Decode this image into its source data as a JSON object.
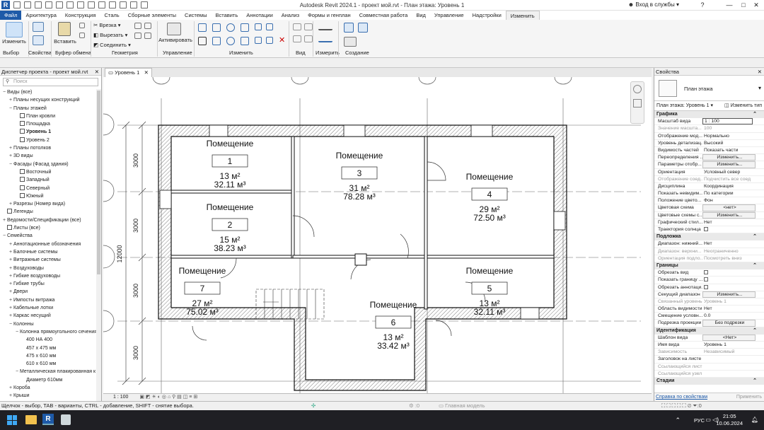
{
  "app": {
    "window_title": "Autodesk Revit 2024.1 - проект мой.rvt - План этажа: Уровень 1",
    "sign_in": "Вход в службы",
    "logo": "R"
  },
  "tabs": [
    "Файл",
    "Архитектура",
    "Конструкция",
    "Сталь",
    "Сборные элементы",
    "Системы",
    "Вставить",
    "Аннотации",
    "Анализ",
    "Формы и генплан",
    "Совместная работа",
    "Вид",
    "Управление",
    "Надстройки",
    "Изменить"
  ],
  "active_tab": "Изменить",
  "ribbon": {
    "modify": "Изменить",
    "paste": "Вставить",
    "cut_geom": "Врезка",
    "cut": "Вырезать",
    "join": "Соединить",
    "activate": "Активировать",
    "panels": {
      "select": "Выбор",
      "properties": "Свойства",
      "clipboard": "Буфер обмена",
      "geometry": "Геометрия",
      "control": "Управление",
      "modify": "Изменить",
      "view": "Вид",
      "measure": "Измерить",
      "create": "Создание"
    }
  },
  "browser": {
    "title": "Диспетчер проекта - проект мой.rvt",
    "search_placeholder": "Поиск",
    "items": [
      {
        "t": "Виды (все)",
        "l": 0,
        "e": "−"
      },
      {
        "t": "Планы несущих конструкций",
        "l": 1,
        "e": "+"
      },
      {
        "t": "Планы этажей",
        "l": 1,
        "e": "−"
      },
      {
        "t": "План кровли",
        "l": 2,
        "v": true
      },
      {
        "t": "Площадка",
        "l": 2,
        "v": true
      },
      {
        "t": "Уровень 1",
        "l": 2,
        "v": true,
        "b": true
      },
      {
        "t": "Уровень 2",
        "l": 2,
        "v": true
      },
      {
        "t": "Планы потолков",
        "l": 1,
        "e": "+"
      },
      {
        "t": "3D виды",
        "l": 1,
        "e": "+"
      },
      {
        "t": "Фасады (Фасад здания)",
        "l": 1,
        "e": "−"
      },
      {
        "t": "Восточный",
        "l": 2,
        "v": true
      },
      {
        "t": "Западный",
        "l": 2,
        "v": true
      },
      {
        "t": "Северный",
        "l": 2,
        "v": true
      },
      {
        "t": "Южный",
        "l": 2,
        "v": true
      },
      {
        "t": "Разрезы (Номер вида)",
        "l": 1,
        "e": "+"
      },
      {
        "t": "Легенды",
        "l": 0,
        "v": true
      },
      {
        "t": "Ведомости/Спецификации (все)",
        "l": 0,
        "e": "+"
      },
      {
        "t": "Листы (все)",
        "l": 0,
        "v": true
      },
      {
        "t": "Семейства",
        "l": 0,
        "e": "−"
      },
      {
        "t": "Аннотационные обозначения",
        "l": 1,
        "e": "+"
      },
      {
        "t": "Балочные системы",
        "l": 1,
        "e": "+"
      },
      {
        "t": "Витражные системы",
        "l": 1,
        "e": "+"
      },
      {
        "t": "Воздуховоды",
        "l": 1,
        "e": "+"
      },
      {
        "t": "Гибкие воздуховоды",
        "l": 1,
        "e": "+"
      },
      {
        "t": "Гибкие трубы",
        "l": 1,
        "e": "+"
      },
      {
        "t": "Двери",
        "l": 1,
        "e": "+"
      },
      {
        "t": "Импосты витража",
        "l": 1,
        "e": "+"
      },
      {
        "t": "Кабельные лотки",
        "l": 1,
        "e": "+"
      },
      {
        "t": "Каркас несущий",
        "l": 1,
        "e": "+"
      },
      {
        "t": "Колонны",
        "l": 1,
        "e": "−"
      },
      {
        "t": "Колонна прямоугольного сечения",
        "l": 2,
        "e": "−"
      },
      {
        "t": "400 НА 400",
        "l": 3
      },
      {
        "t": "457 x 475 мм",
        "l": 3
      },
      {
        "t": "475 x 610 мм",
        "l": 3
      },
      {
        "t": "610 x 610 мм",
        "l": 3
      },
      {
        "t": "Металлическая плакированная к",
        "l": 2,
        "e": "−"
      },
      {
        "t": "Диаметр 610мм",
        "l": 3
      },
      {
        "t": "Короба",
        "l": 1,
        "e": "+"
      },
      {
        "t": "Крыши",
        "l": 1,
        "e": "+"
      }
    ]
  },
  "view_tab": "Уровень 1",
  "view_scale": "1 : 100",
  "plan": {
    "room_label": "Помещение",
    "rooms": [
      {
        "n": "1",
        "area": "13 м²",
        "vol": "32.11 м³"
      },
      {
        "n": "2",
        "area": "15 м²",
        "vol": "38.23 м³"
      },
      {
        "n": "3",
        "area": "31 м²",
        "vol": "78.28 м³"
      },
      {
        "n": "4",
        "area": "29 м²",
        "vol": "72.50 м³"
      },
      {
        "n": "5",
        "area": "13 м²",
        "vol": "32.11 м³"
      },
      {
        "n": "6",
        "area": "13 м²",
        "vol": "33.42 м³"
      },
      {
        "n": "7",
        "area": "27 м²",
        "vol": "75.02 м³"
      }
    ],
    "dims": {
      "d1": "3000",
      "d2": "3000",
      "d3": "3000",
      "d4": "3000",
      "total": "12000"
    }
  },
  "props": {
    "title": "Свойства",
    "type_name": "План этажа",
    "instance": "План этажа: Уровень 1",
    "edit_type": "Изменить тип",
    "sections": {
      "graphics": "Графика",
      "underlay": "Подложка",
      "extents": "Границы",
      "identity": "Идентификация",
      "phasing": "Стадии"
    },
    "graphics": [
      {
        "k": "Масштаб вида",
        "v": "1 : 100",
        "input": true
      },
      {
        "k": "Значение масшта...",
        "v": "100",
        "dis": true
      },
      {
        "k": "Отображение мод...",
        "v": "Нормально"
      },
      {
        "k": "Уровень детализац...",
        "v": "Высокий"
      },
      {
        "k": "Видимость частей",
        "v": "Показать части"
      },
      {
        "k": "Переопределения ...",
        "v": "Изменить...",
        "btn": true
      },
      {
        "k": "Параметры отобр...",
        "v": "Изменить...",
        "btn": true
      },
      {
        "k": "Ориентация",
        "v": "Условный север"
      },
      {
        "k": "Отображение соед...",
        "v": "Подчистить все соед",
        "dis": true
      },
      {
        "k": "Дисциплина",
        "v": "Координация"
      },
      {
        "k": "Показать невидим...",
        "v": "По категории"
      },
      {
        "k": "Положение цвето...",
        "v": "Фон"
      },
      {
        "k": "Цветовая схема",
        "v": "<нет>",
        "btn": true
      },
      {
        "k": "Цветовые схемы с...",
        "v": "Изменить...",
        "btn": true
      },
      {
        "k": "Графический стил...",
        "v": "Нет"
      },
      {
        "k": "Траектория солнца",
        "v": "",
        "chk": true
      }
    ],
    "underlay": [
      {
        "k": "Диапазон: нижний...",
        "v": "Нет"
      },
      {
        "k": "Диапазон: верхни...",
        "v": "Неограниченно",
        "dis": true
      },
      {
        "k": "Ориентация подло...",
        "v": "Посмотреть вниз",
        "dis": true
      }
    ],
    "extents": [
      {
        "k": "Обрезать вид",
        "v": "",
        "chk": true
      },
      {
        "k": "Показать границу ...",
        "v": "",
        "chk": true
      },
      {
        "k": "Обрезать аннотаци...",
        "v": "",
        "chk": true
      },
      {
        "k": "Секущий диапазон",
        "v": "Изменить...",
        "btn": true
      },
      {
        "k": "Связанный уровень",
        "v": "Уровень 1",
        "dis": true
      },
      {
        "k": "Область видимости",
        "v": "Нет"
      },
      {
        "k": "Смещение условн...",
        "v": "0.0"
      },
      {
        "k": "Подрезка проекции",
        "v": "Без подрезки",
        "btn": true
      }
    ],
    "identity": [
      {
        "k": "Шаблон вида",
        "v": "<Нет>",
        "btn": true
      },
      {
        "k": "Имя вида",
        "v": "Уровень 1"
      },
      {
        "k": "Зависимость",
        "v": "Независимый",
        "dis": true
      },
      {
        "k": "Заголовок на листе",
        "v": ""
      },
      {
        "k": "Ссылающийся лист",
        "v": "",
        "dis": true
      },
      {
        "k": "Ссылающийся узел",
        "v": "",
        "dis": true
      }
    ],
    "help_link": "Справка по свойствам",
    "apply": "Применить"
  },
  "status": {
    "hint": "Щелчок - выбор, TAB - варианты, CTRL - добавление, SHIFT - снятие выбора.",
    "model": "Главная модель",
    "zero": ":0"
  },
  "taskbar": {
    "lang": "РУС",
    "time": "21:05",
    "date": "10.06.2024"
  },
  "colors": {
    "accent": "#1e5aa8",
    "hatch": "#333333"
  }
}
